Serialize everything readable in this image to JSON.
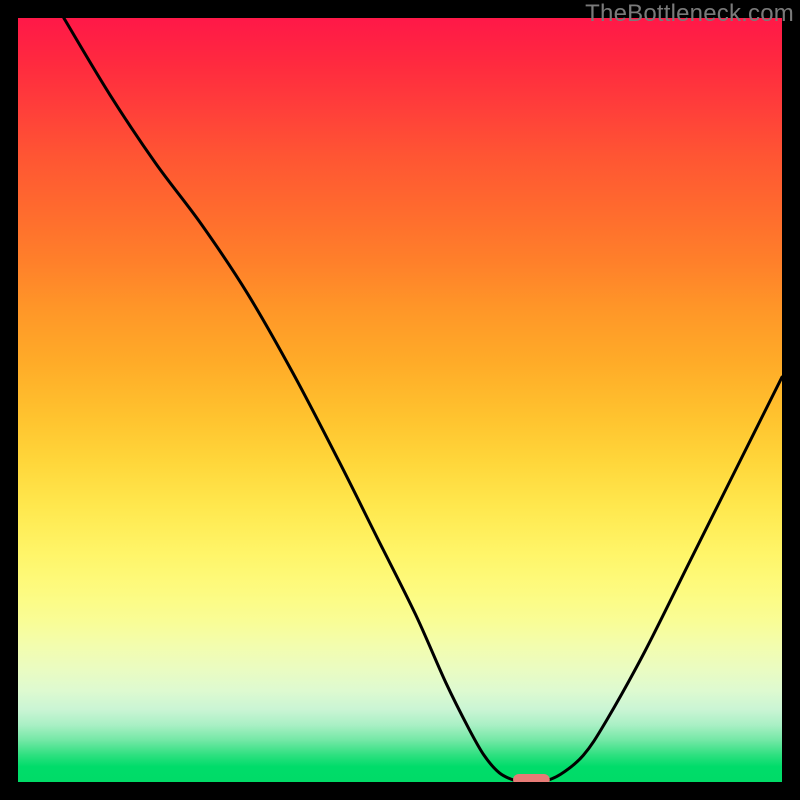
{
  "watermark": "TheBottleneck.com",
  "chart_data": {
    "type": "line",
    "title": "",
    "xlabel": "",
    "ylabel": "",
    "xlim": [
      0,
      100
    ],
    "ylim": [
      0,
      100
    ],
    "grid": false,
    "legend": false,
    "series": [
      {
        "name": "curve",
        "x": [
          6,
          12,
          18,
          24,
          30,
          36,
          42,
          47,
          52,
          56,
          59,
          61,
          63,
          65,
          66.5,
          68.5,
          71,
          74,
          77,
          82,
          88,
          94,
          100
        ],
        "values": [
          100,
          90,
          81,
          73,
          64,
          53.5,
          42,
          32,
          22,
          13,
          7,
          3.5,
          1.2,
          0.2,
          0,
          0,
          1,
          3.5,
          8,
          17,
          29,
          41,
          53
        ]
      }
    ],
    "marker": {
      "name": "optimal-marker",
      "x": 67.2,
      "y": 0.3,
      "width_pct": 4.8,
      "height_pct": 1.5,
      "color": "#e77b76"
    },
    "background_gradient": {
      "top": "#ff1848",
      "mid": "#ffd63a",
      "bottom": "#00db67"
    }
  }
}
